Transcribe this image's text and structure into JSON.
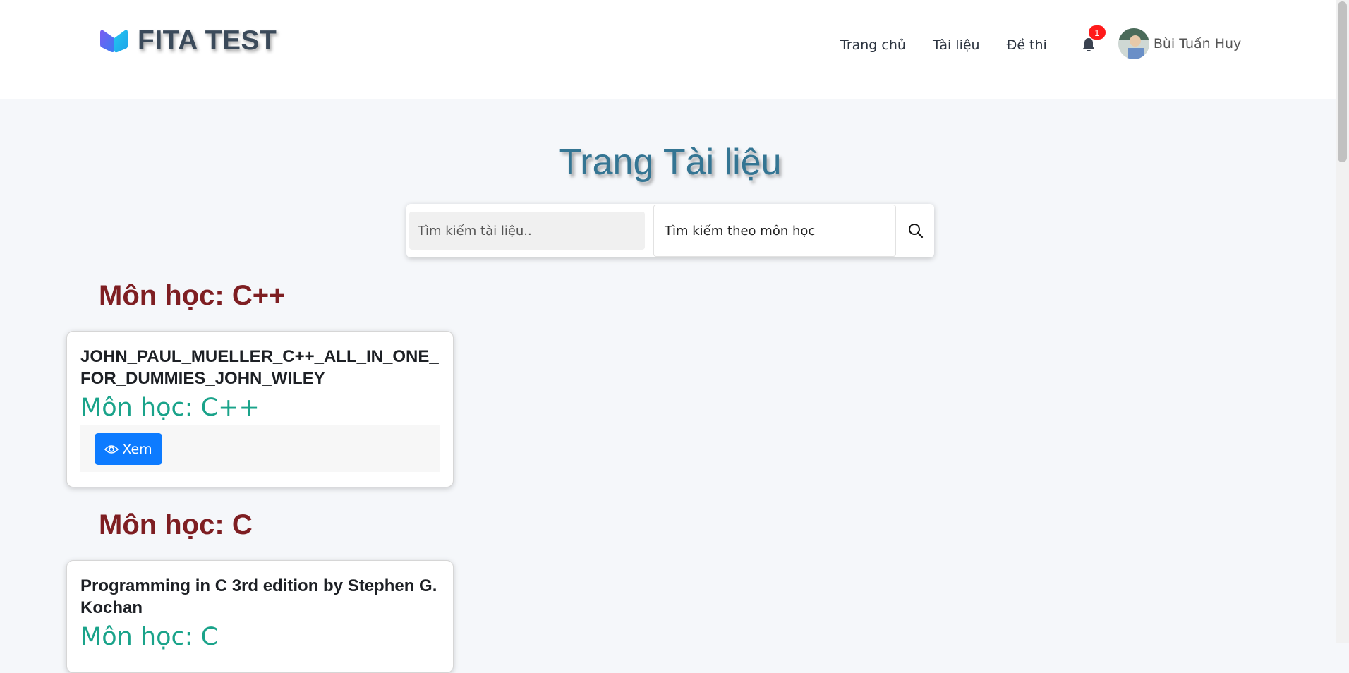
{
  "header": {
    "brand": "FITA TEST",
    "nav": {
      "home": "Trang chủ",
      "documents": "Tài liệu",
      "exams": "Đề thi"
    },
    "notification_count": "1",
    "user_name": "Bùi Tuấn Huy"
  },
  "main": {
    "title": "Trang Tài liệu",
    "search": {
      "placeholder": "Tìm kiếm tài liệu..",
      "subject_select": "Tìm kiếm theo môn học"
    },
    "groups": [
      {
        "heading": "Môn học: C++",
        "document": {
          "title": "JOHN_PAUL_MUELLER_C++_ALL_IN_ONE_FOR_DUMMIES_JOHN_WILEY",
          "subject": "Môn học: C++",
          "view_label": "Xem"
        }
      },
      {
        "heading": "Môn học: C",
        "document": {
          "title": "Programming in C 3rd edition by Stephen G. Kochan",
          "subject": "Môn học: C"
        }
      }
    ]
  },
  "colors": {
    "title": "#347593",
    "heading": "#7e1e22",
    "subject": "#1aa38a",
    "primary_button": "#0d7bff",
    "badge": "#ff1a1a"
  }
}
